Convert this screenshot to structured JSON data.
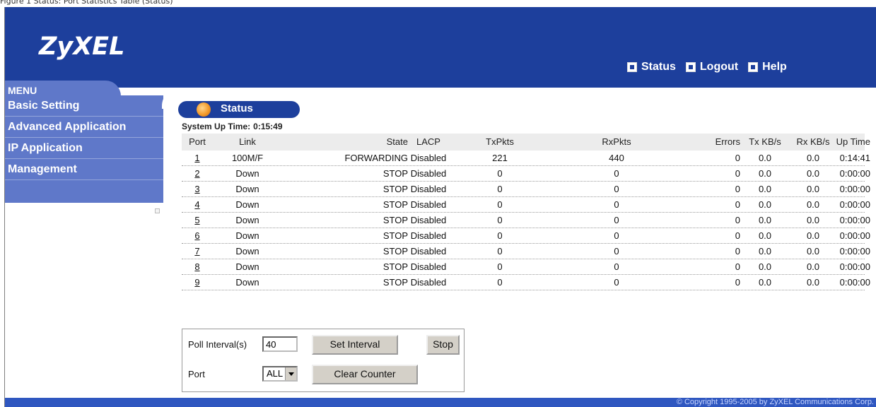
{
  "caption": "Figure 1 Status: Port Statistics Table (Status)",
  "brand": {
    "logo": "ZyXEL"
  },
  "header_links": [
    {
      "label": "Status",
      "icon": "home-icon"
    },
    {
      "label": "Logout",
      "icon": "logout-icon"
    },
    {
      "label": "Help",
      "icon": "help-icon"
    }
  ],
  "menu": {
    "title": "MENU",
    "items": [
      {
        "label": "Basic Setting"
      },
      {
        "label": "Advanced Application"
      },
      {
        "label": "IP Application"
      },
      {
        "label": "Management"
      }
    ]
  },
  "status": {
    "title": "Status",
    "uptime_label": "System Up Time:",
    "uptime_value": "0:15:49"
  },
  "table": {
    "headers": [
      "Port",
      "Link",
      "State",
      "LACP",
      "TxPkts",
      "RxPkts",
      "Errors",
      "Tx KB/s",
      "Rx KB/s",
      "Up Time"
    ],
    "rows": [
      {
        "port": "1",
        "link": "100M/F",
        "state": "FORWARDING",
        "lacp": "Disabled",
        "tx": "221",
        "rx": "440",
        "errors": "0",
        "txkb": "0.0",
        "rxkb": "0.0",
        "up": "0:14:41"
      },
      {
        "port": "2",
        "link": "Down",
        "state": "STOP",
        "lacp": "Disabled",
        "tx": "0",
        "rx": "0",
        "errors": "0",
        "txkb": "0.0",
        "rxkb": "0.0",
        "up": "0:00:00"
      },
      {
        "port": "3",
        "link": "Down",
        "state": "STOP",
        "lacp": "Disabled",
        "tx": "0",
        "rx": "0",
        "errors": "0",
        "txkb": "0.0",
        "rxkb": "0.0",
        "up": "0:00:00"
      },
      {
        "port": "4",
        "link": "Down",
        "state": "STOP",
        "lacp": "Disabled",
        "tx": "0",
        "rx": "0",
        "errors": "0",
        "txkb": "0.0",
        "rxkb": "0.0",
        "up": "0:00:00"
      },
      {
        "port": "5",
        "link": "Down",
        "state": "STOP",
        "lacp": "Disabled",
        "tx": "0",
        "rx": "0",
        "errors": "0",
        "txkb": "0.0",
        "rxkb": "0.0",
        "up": "0:00:00"
      },
      {
        "port": "6",
        "link": "Down",
        "state": "STOP",
        "lacp": "Disabled",
        "tx": "0",
        "rx": "0",
        "errors": "0",
        "txkb": "0.0",
        "rxkb": "0.0",
        "up": "0:00:00"
      },
      {
        "port": "7",
        "link": "Down",
        "state": "STOP",
        "lacp": "Disabled",
        "tx": "0",
        "rx": "0",
        "errors": "0",
        "txkb": "0.0",
        "rxkb": "0.0",
        "up": "0:00:00"
      },
      {
        "port": "8",
        "link": "Down",
        "state": "STOP",
        "lacp": "Disabled",
        "tx": "0",
        "rx": "0",
        "errors": "0",
        "txkb": "0.0",
        "rxkb": "0.0",
        "up": "0:00:00"
      },
      {
        "port": "9",
        "link": "Down",
        "state": "STOP",
        "lacp": "Disabled",
        "tx": "0",
        "rx": "0",
        "errors": "0",
        "txkb": "0.0",
        "rxkb": "0.0",
        "up": "0:00:00"
      }
    ]
  },
  "controls": {
    "poll_label": "Poll Interval(s)",
    "poll_value": "40",
    "set_interval": "Set Interval",
    "stop": "Stop",
    "port_label": "Port",
    "port_selected": "ALL",
    "clear_counter": "Clear Counter"
  },
  "footer": {
    "copyright": "© Copyright 1995-2005 by ZyXEL Communications Corp."
  },
  "colors": {
    "header": "#1d3f9c",
    "menu": "#5f78c9",
    "footer": "#2f57c0"
  }
}
